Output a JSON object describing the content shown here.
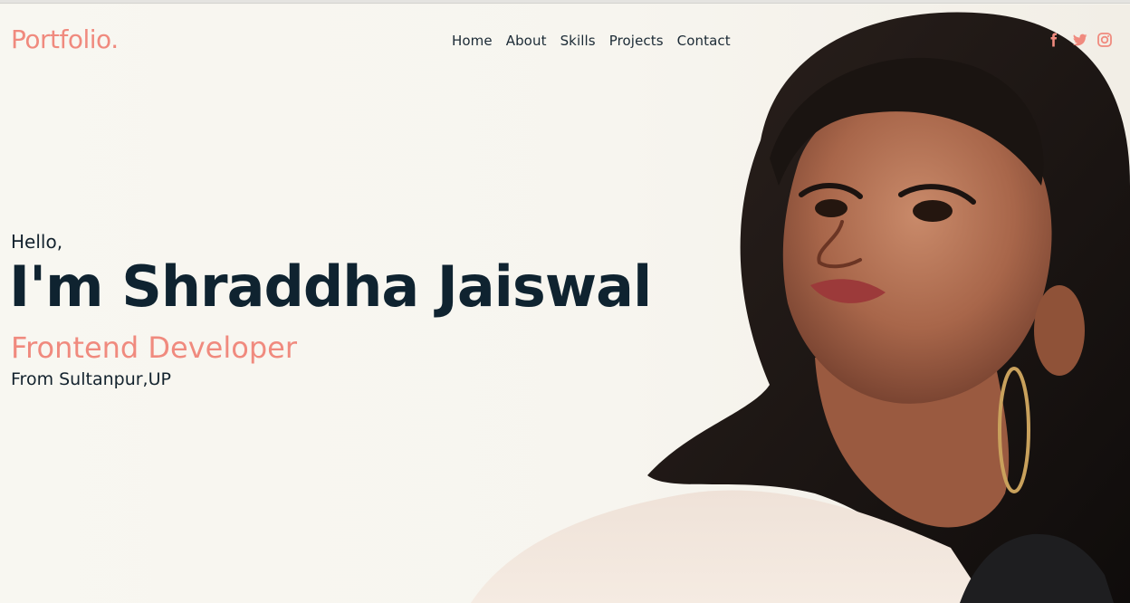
{
  "header": {
    "logo": "Portfolio.",
    "nav": [
      "Home",
      "About",
      "Skills",
      "Projects",
      "Contact"
    ],
    "social_icons": [
      "facebook-icon",
      "twitter-icon",
      "instagram-icon"
    ]
  },
  "hero": {
    "greeting": "Hello,",
    "name": "I'm Shraddha Jaiswal",
    "role": "Frontend Developer",
    "location": "From Sultanpur,UP",
    "image": "profile-photo"
  },
  "colors": {
    "accent": "#f08a7e",
    "text_dark": "#0f2330",
    "background": "#f7f5ef"
  }
}
